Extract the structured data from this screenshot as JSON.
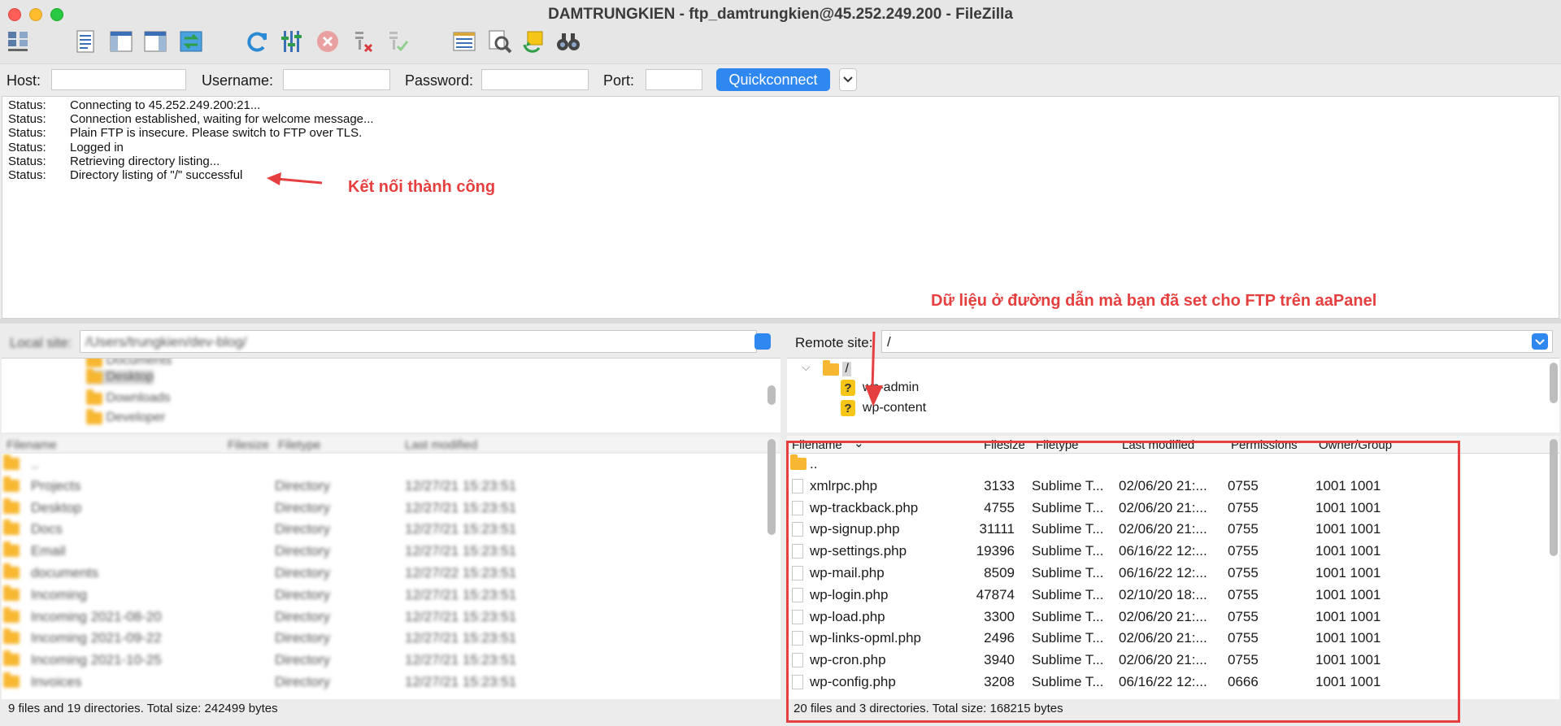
{
  "window": {
    "title": "DAMTRUNGKIEN - ftp_damtrungkien@45.252.249.200 - FileZilla"
  },
  "toolbar": {
    "icons": [
      "site-manager-icon",
      "toggle-log-icon",
      "toggle-local-tree-icon",
      "toggle-remote-tree-icon",
      "transfer-queue-icon",
      "refresh-icon",
      "process-queue-icon",
      "cancel-icon",
      "disconnect-icon",
      "reconnect-icon",
      "directory-compare-icon",
      "search-remote-icon",
      "sync-browse-icon",
      "find-files-icon"
    ]
  },
  "quickconnect": {
    "host_label": "Host:",
    "host_value": "",
    "username_label": "Username:",
    "username_value": "",
    "password_label": "Password:",
    "password_value": "",
    "port_label": "Port:",
    "port_value": "",
    "button_label": "Quickconnect"
  },
  "log": {
    "lines": [
      {
        "label": "Status:",
        "text": "Connecting to 45.252.249.200:21..."
      },
      {
        "label": "Status:",
        "text": "Connection established, waiting for welcome message..."
      },
      {
        "label": "Status:",
        "text": "Plain FTP is insecure. Please switch to FTP over TLS."
      },
      {
        "label": "Status:",
        "text": "Logged in"
      },
      {
        "label": "Status:",
        "text": "Retrieving directory listing..."
      },
      {
        "label": "Status:",
        "text": "Directory listing of \"/\" successful"
      }
    ]
  },
  "annotations": {
    "success": "Kết nối thành công",
    "data_path": "Dữ liệu ở đường dẫn mà bạn đã set cho FTP trên aaPanel"
  },
  "local": {
    "site_label": "Local site:",
    "site_path": "/Users/trungkien/dev-blog/",
    "tree": [
      "Documents",
      "Desktop",
      "Downloads",
      "Developer"
    ],
    "columns": [
      "Filename",
      "Filesize",
      "Filetype",
      "Last modified"
    ],
    "rows": [
      {
        "name": "..",
        "type": "",
        "modified": ""
      },
      {
        "name": "Projects",
        "type": "Directory",
        "modified": "12/27/21 15:23:51"
      },
      {
        "name": "Desktop",
        "type": "Directory",
        "modified": "12/27/21 15:23:51"
      },
      {
        "name": "Docs",
        "type": "Directory",
        "modified": "12/27/21 15:23:51"
      },
      {
        "name": "Email",
        "type": "Directory",
        "modified": "12/27/21 15:23:51"
      },
      {
        "name": "documents",
        "type": "Directory",
        "modified": "12/27/22 15:23:51"
      },
      {
        "name": "Incoming",
        "type": "Directory",
        "modified": "12/27/21 15:23:51"
      },
      {
        "name": "Incoming 2021-08-20",
        "type": "Directory",
        "modified": "12/27/21 15:23:51"
      },
      {
        "name": "Incoming 2021-09-22",
        "type": "Directory",
        "modified": "12/27/21 15:23:51"
      },
      {
        "name": "Incoming 2021-10-25",
        "type": "Directory",
        "modified": "12/27/21 15:23:51"
      },
      {
        "name": "Invoices",
        "type": "Directory",
        "modified": "12/27/21 15:23:51"
      }
    ],
    "status": "9 files and 19 directories. Total size: 242499 bytes"
  },
  "remote": {
    "site_label": "Remote site:",
    "site_path": "/",
    "tree_root": "/",
    "tree": [
      "wp-admin",
      "wp-content"
    ],
    "columns": [
      "Filename",
      "Filesize",
      "Filetype",
      "Last modified",
      "Permissions",
      "Owner/Group"
    ],
    "parent": "..",
    "rows": [
      {
        "name": "xmlrpc.php",
        "size": "3133",
        "type": "Sublime T...",
        "modified": "02/06/20 21:...",
        "perm": "0755",
        "owner": "1001 1001"
      },
      {
        "name": "wp-trackback.php",
        "size": "4755",
        "type": "Sublime T...",
        "modified": "02/06/20 21:...",
        "perm": "0755",
        "owner": "1001 1001"
      },
      {
        "name": "wp-signup.php",
        "size": "31111",
        "type": "Sublime T...",
        "modified": "02/06/20 21:...",
        "perm": "0755",
        "owner": "1001 1001"
      },
      {
        "name": "wp-settings.php",
        "size": "19396",
        "type": "Sublime T...",
        "modified": "06/16/22 12:...",
        "perm": "0755",
        "owner": "1001 1001"
      },
      {
        "name": "wp-mail.php",
        "size": "8509",
        "type": "Sublime T...",
        "modified": "06/16/22 12:...",
        "perm": "0755",
        "owner": "1001 1001"
      },
      {
        "name": "wp-login.php",
        "size": "47874",
        "type": "Sublime T...",
        "modified": "02/10/20 18:...",
        "perm": "0755",
        "owner": "1001 1001"
      },
      {
        "name": "wp-load.php",
        "size": "3300",
        "type": "Sublime T...",
        "modified": "02/06/20 21:...",
        "perm": "0755",
        "owner": "1001 1001"
      },
      {
        "name": "wp-links-opml.php",
        "size": "2496",
        "type": "Sublime T...",
        "modified": "02/06/20 21:...",
        "perm": "0755",
        "owner": "1001 1001"
      },
      {
        "name": "wp-cron.php",
        "size": "3940",
        "type": "Sublime T...",
        "modified": "02/06/20 21:...",
        "perm": "0755",
        "owner": "1001 1001"
      },
      {
        "name": "wp-config.php",
        "size": "3208",
        "type": "Sublime T...",
        "modified": "06/16/22 12:...",
        "perm": "0666",
        "owner": "1001 1001"
      }
    ],
    "status": "20 files and 3 directories. Total size: 168215 bytes"
  }
}
